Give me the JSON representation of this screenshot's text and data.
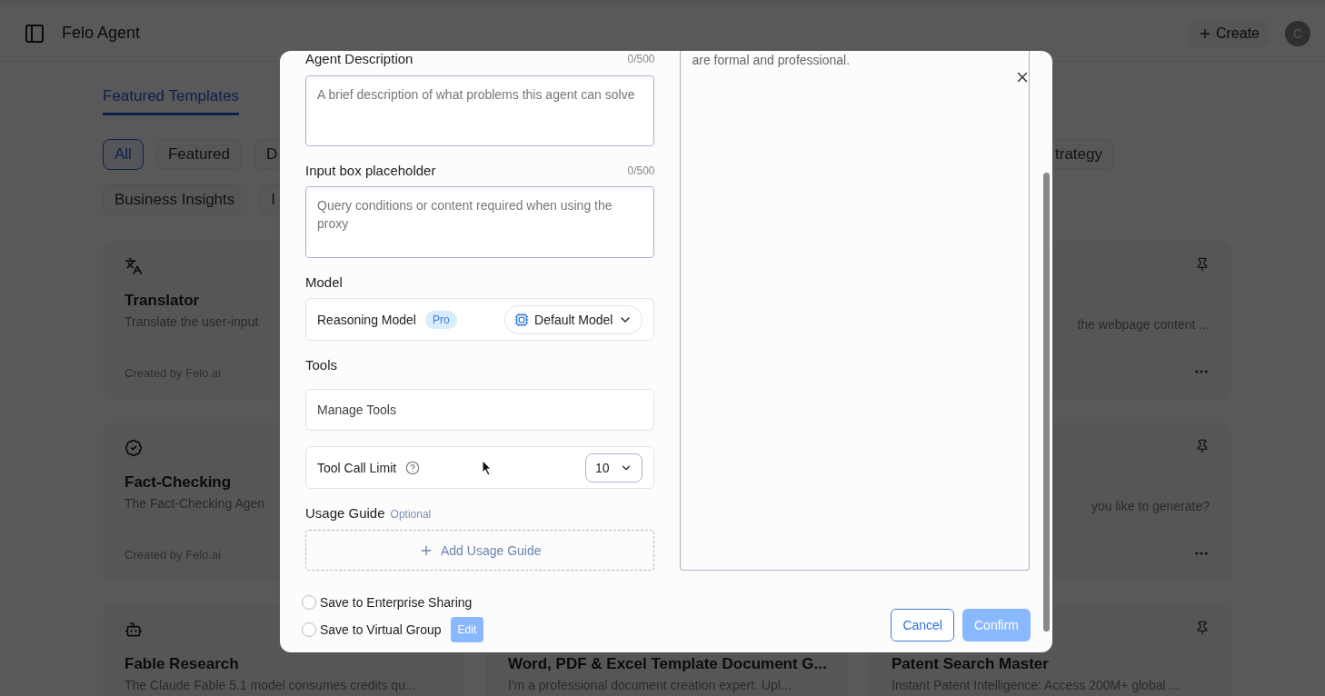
{
  "header": {
    "title": "Felo Agent",
    "create_button": "Create",
    "avatar": "C"
  },
  "tabs": [
    {
      "label": "Featured Templates",
      "selected": true
    }
  ],
  "category_rows": [
    [
      {
        "label": "All",
        "selected": true
      },
      {
        "label": "Featured",
        "selected": false
      },
      {
        "label": "D",
        "selected": false
      },
      {
        "label": "trategy",
        "selected": false
      }
    ],
    [
      {
        "label": "Business Insights",
        "selected": false
      },
      {
        "label": "I",
        "selected": false
      }
    ]
  ],
  "card_columns": [
    [
      {
        "kind": "full",
        "title": "Translator",
        "description": "Translate the user-input",
        "footer": "Created by Felo.ai"
      },
      {
        "kind": "full",
        "title": "Fact-Checking",
        "description": "The Fact-Checking Agen",
        "footer": "Created by Felo.ai"
      },
      {
        "kind": "full",
        "title": "Fable Research",
        "description": "The Claude Fable 5.1 model consumes credits qu..."
      }
    ],
    [
      null,
      null,
      {
        "kind": "full",
        "title": "Word, PDF & Excel Template Document G...",
        "description": "I'm a professional document creation expert. Upl..."
      }
    ],
    [
      {
        "kind": "clipped",
        "description": "the webpage content ..."
      },
      {
        "kind": "clipped",
        "description": "you like to generate?"
      },
      {
        "kind": "full",
        "title": "Patent Search Master",
        "description": "Instant Patent Intelligence: Access 200M+ global ..."
      }
    ]
  ],
  "dialog": {
    "fields": [
      {
        "label": "Agent Description",
        "counter": "0/500",
        "placeholder": "A brief description of what problems this agent can solve"
      },
      {
        "label": "Input box placeholder",
        "counter": "0/500",
        "placeholder": "Query conditions or content required when using the proxy"
      }
    ],
    "model": {
      "label": "Model",
      "name": "Reasoning Model",
      "badge": "Pro",
      "value": "Default Model"
    },
    "tools": {
      "label": "Tools",
      "manage": "Manage Tools",
      "limit_label": "Tool Call Limit",
      "limit_value": "10"
    },
    "usage_guide": {
      "label": "Usage Guide",
      "hint": "Optional",
      "add_button": "Add Usage Guide"
    },
    "preview_text": "are formal and professional.",
    "options": [
      {
        "label": "Save to Enterprise Sharing",
        "checked": false
      },
      {
        "label": "Save to Virtual Group",
        "checked": false,
        "action": "Edit"
      }
    ],
    "buttons": [
      {
        "label": "Cancel",
        "kind": "secondary",
        "disabled": false
      },
      {
        "label": "Confirm",
        "kind": "primary",
        "disabled": true
      }
    ]
  }
}
